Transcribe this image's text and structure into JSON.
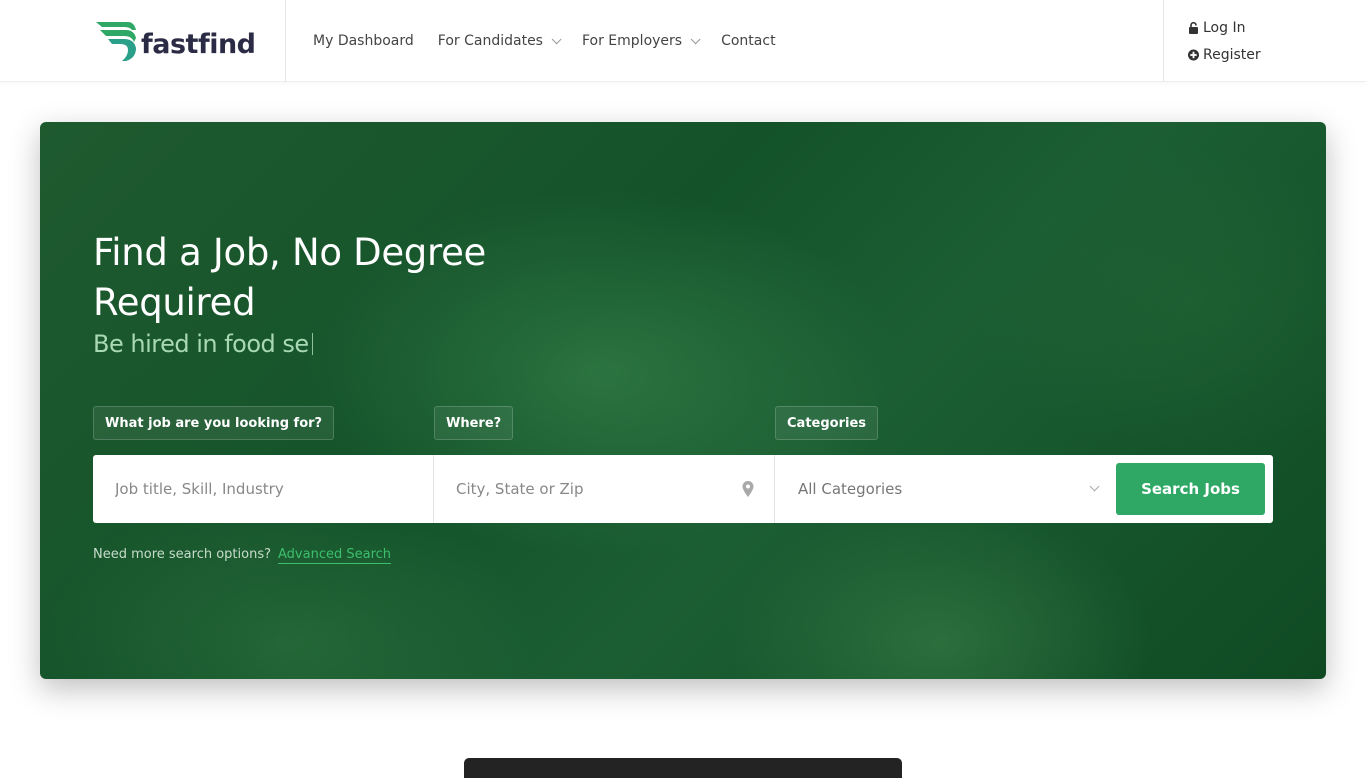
{
  "header": {
    "logo_text": "fastfind",
    "nav": [
      {
        "label": "My Dashboard",
        "has_dropdown": false
      },
      {
        "label": "For Candidates",
        "has_dropdown": true
      },
      {
        "label": "For Employers",
        "has_dropdown": true
      },
      {
        "label": "Contact",
        "has_dropdown": false
      }
    ],
    "auth": {
      "login_label": "Log In",
      "register_label": "Register"
    }
  },
  "hero": {
    "title": "Find a Job, No Degree Required",
    "subtitle_typing": "Be hired in food se",
    "labels": {
      "what": "What job are you looking for?",
      "where": "Where?",
      "categories": "Categories"
    },
    "search": {
      "keyword_placeholder": "Job title, Skill, Industry",
      "location_placeholder": "City, State or Zip",
      "category_selected": "All Categories",
      "button_label": "Search Jobs"
    },
    "more_options_text": "Need more search options?",
    "advanced_search_label": "Advanced Search"
  },
  "colors": {
    "brand_green": "#2fa866",
    "hero_bg": "#14532a",
    "link_green": "#3cbf6e",
    "logo_text": "#2b2b45"
  }
}
